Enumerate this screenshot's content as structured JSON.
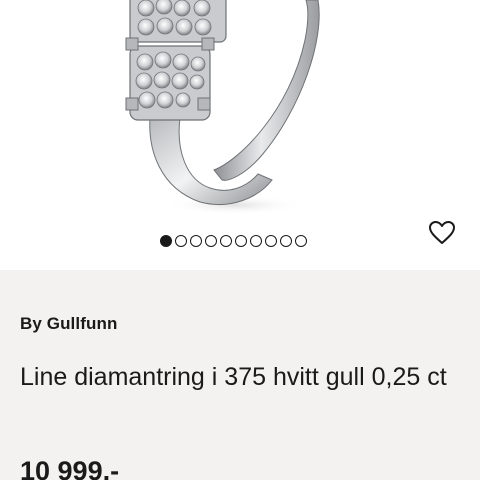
{
  "product": {
    "brand": "By Gullfunn",
    "title": "Line diamantring i 375 hvitt gull 0,25 ct",
    "price": "10 999,-"
  },
  "gallery": {
    "image_alt": "ring",
    "slide_count": 10,
    "active_slide": 1
  },
  "icons": {
    "wishlist": "heart-outline-icon"
  },
  "colors": {
    "page_background": "#f3f2f0",
    "image_background": "#ffffff",
    "text": "#1a1a1a"
  }
}
